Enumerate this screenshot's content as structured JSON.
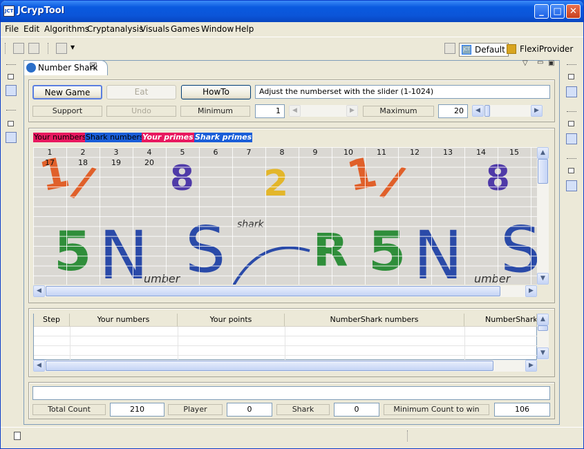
{
  "window": {
    "title": "JCrypTool",
    "icon": "jct-app-icon"
  },
  "menu": [
    "File",
    "Edit",
    "Algorithms",
    "Cryptanalysis",
    "Visuals",
    "Games",
    "Window",
    "Help"
  ],
  "perspectives": {
    "default": "Default",
    "flexi": "FlexiProvider"
  },
  "tab": {
    "label": "Number Shark"
  },
  "controls": {
    "new_game": "New Game",
    "eat": "Eat",
    "howto": "HowTo",
    "hint": "Adjust the numberset with the slider (1-1024)",
    "support": "Support",
    "undo": "Undo",
    "minimum_label": "Minimum",
    "minimum_value": "1",
    "maximum_label": "Maximum",
    "maximum_value": "20"
  },
  "legend": {
    "your_numbers": "Your numbers",
    "shark_numbers": "Shark numbers",
    "your_primes": "Your primes",
    "shark_primes": "Shark primes",
    "colors": {
      "your": "#e8185f",
      "shark": "#1a5ed8"
    }
  },
  "board": {
    "row1": [
      "1",
      "2",
      "3",
      "4",
      "5",
      "6",
      "7",
      "8",
      "9",
      "10",
      "11",
      "12",
      "13",
      "14",
      "15"
    ],
    "row2": [
      "17",
      "18",
      "19",
      "20"
    ],
    "background_text": {
      "top": [
        "1",
        "8",
        "2",
        "1",
        "8"
      ],
      "bottom": [
        "5",
        "N",
        "S",
        "R",
        "5",
        "N",
        "S"
      ],
      "small": [
        "shark",
        "umber",
        "umber"
      ]
    }
  },
  "table": {
    "columns": [
      "Step",
      "Your numbers",
      "Your points",
      "NumberShark numbers",
      "NumberShark p"
    ]
  },
  "score": {
    "total_count_label": "Total Count",
    "total_count": "210",
    "player_label": "Player",
    "player": "0",
    "shark_label": "Shark",
    "shark": "0",
    "min_win_label": "Minimum Count to win",
    "min_win": "106"
  }
}
